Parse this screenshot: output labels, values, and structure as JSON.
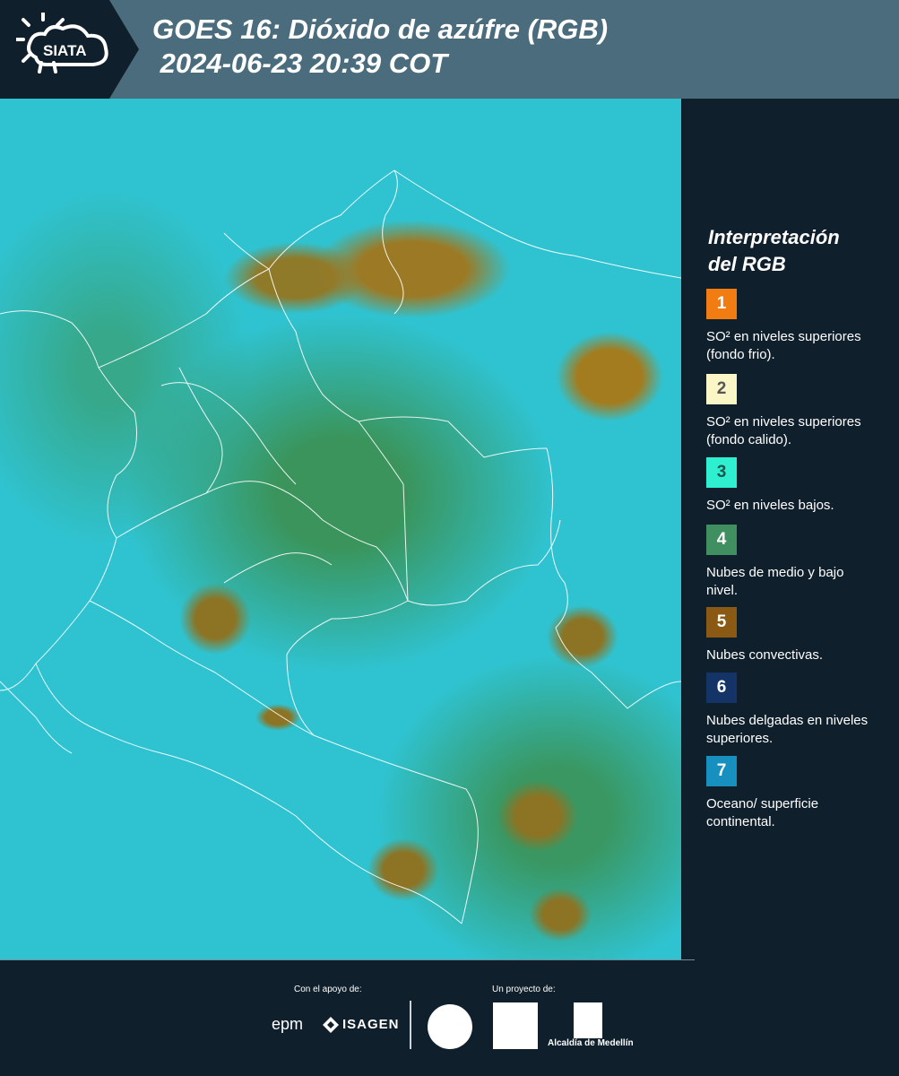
{
  "header": {
    "logo_text": "SIATA",
    "title_line1": "GOES 16: Dióxido de azúfre (RGB)",
    "title_line2": " 2024-06-23 20:39 COT"
  },
  "legend": {
    "title_line1": "Interpretación",
    "title_line2": "del RGB",
    "items": [
      {
        "num": "1",
        "label": "SO² en niveles superiores (fondo frio).",
        "color": "#f07c12",
        "text_color": "#ffffff"
      },
      {
        "num": "2",
        "label": "SO² en niveles superiores (fondo calido).",
        "color": "#fbf6c6",
        "text_color": "#555555"
      },
      {
        "num": "3",
        "label": "SO² en niveles bajos.",
        "color": "#2ef0d0",
        "text_color": "#1a5550"
      },
      {
        "num": "4",
        "label": "Nubes de medio y bajo nivel.",
        "color": "#3f8f60",
        "text_color": "#ffffff"
      },
      {
        "num": "5",
        "label": "Nubes convectivas.",
        "color": "#8a5a14",
        "text_color": "#ffffff"
      },
      {
        "num": "6",
        "label": "Nubes delgadas en niveles superiores.",
        "color": "#143366",
        "text_color": "#ffffff"
      },
      {
        "num": "7",
        "label": "Oceano/ superficie continental.",
        "color": "#1790c0",
        "text_color": "#ffffff"
      }
    ]
  },
  "footer": {
    "support_label": "Con el apoyo de:",
    "project_label": "Un proyecto de:",
    "sponsor_epm": "epm",
    "sponsor_isagen": "ISAGEN",
    "alcaldia": "Alcaldía de Medellín"
  }
}
